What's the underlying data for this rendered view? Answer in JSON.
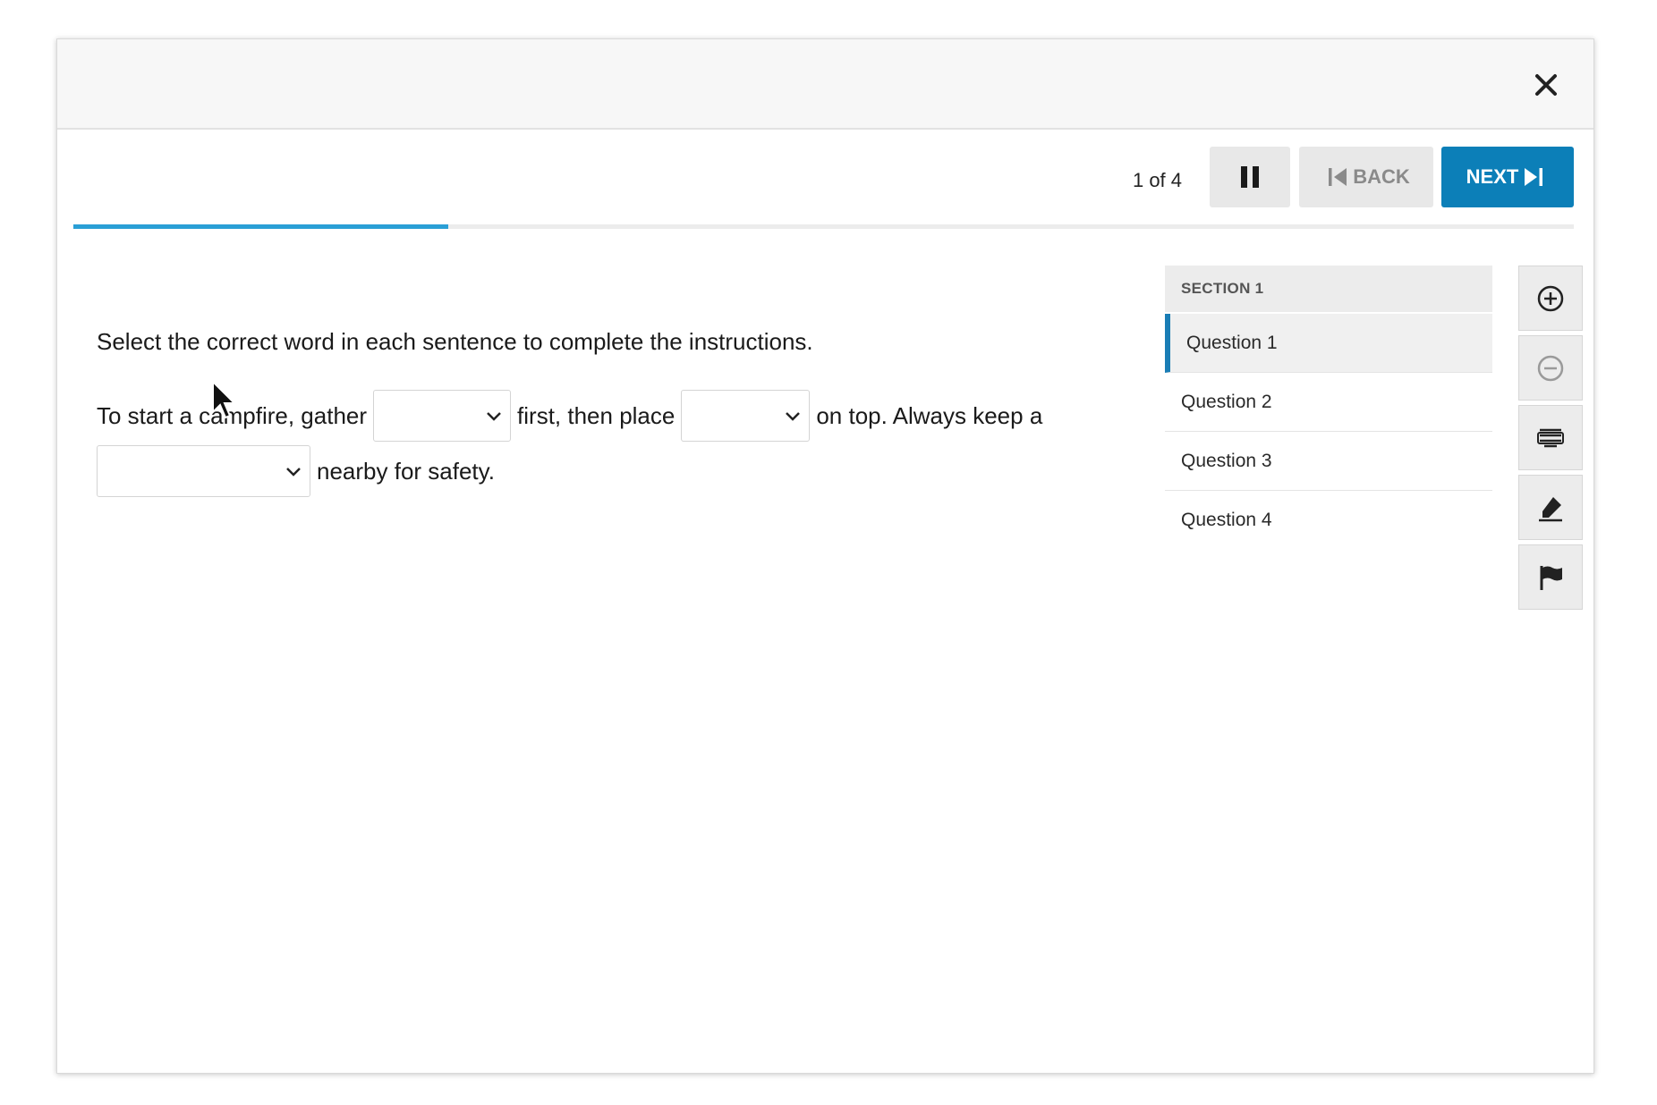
{
  "toolbar": {
    "counter": "1 of 4",
    "pause_icon": "pause-icon",
    "back_label": "BACK",
    "next_label": "NEXT",
    "progress_fraction": 0.25,
    "accent_color": "#0c7fb8",
    "progress_color": "#2a9fd6"
  },
  "question": {
    "instructions": "Select the correct word in each sentence to complete the instructions.",
    "sentence_parts": {
      "p1": "To start a campfire, gather",
      "p2": "first, then place",
      "p3": "on top. Always keep a",
      "p4": "nearby for safety."
    },
    "dropdowns": [
      {
        "selected": ""
      },
      {
        "selected": ""
      },
      {
        "selected": ""
      }
    ]
  },
  "nav": {
    "section": "SECTION 1",
    "items": [
      {
        "label": "Question 1",
        "active": true
      },
      {
        "label": "Question 2",
        "active": false
      },
      {
        "label": "Question 3",
        "active": false
      },
      {
        "label": "Question 4",
        "active": false
      }
    ]
  },
  "tools": [
    "zoom-in-icon",
    "zoom-out-icon",
    "line-reader-icon",
    "highlighter-icon",
    "flag-icon"
  ],
  "window": {
    "close_icon": "close-icon"
  }
}
